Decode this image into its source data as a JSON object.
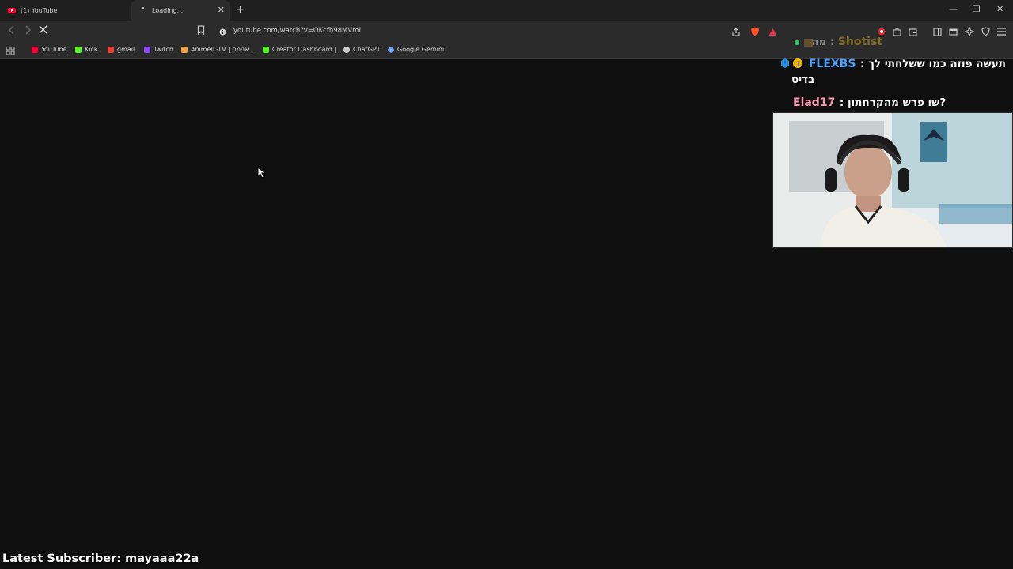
{
  "tabs": [
    {
      "label": "(1) YouTube",
      "icon": "youtube-icon"
    },
    {
      "label": "Loading...",
      "icon": "loading-icon"
    }
  ],
  "window": {
    "minimize": "—",
    "restore": "❐",
    "close": "✕"
  },
  "address": {
    "url": "youtube.com/watch?v=OKcfh98MVmI"
  },
  "bookmarks": [
    {
      "label": "YouTube",
      "color": "#ff0033"
    },
    {
      "label": "Kick",
      "color": "#53fc18"
    },
    {
      "label": "gmail",
      "color": "#ea4335"
    },
    {
      "label": "Twitch",
      "color": "#9146ff"
    },
    {
      "label": "AnimeIL-TV | אנימה...",
      "color": "#f2a33a"
    },
    {
      "label": "Creator Dashboard |...",
      "color": "#53fc18"
    },
    {
      "label": "ChatGPT",
      "color": "#cccccc"
    },
    {
      "label": "Google Gemini",
      "color": "#6fa8ff"
    }
  ],
  "chat": [
    {
      "user": "Shotist",
      "msg": "מה",
      "user_color": "#c9a227"
    },
    {
      "user": "FLEXBS",
      "msg": "תעשה פוזה כמו ששלחתי לך",
      "wrap": "בדיס",
      "user_color": "#4aa3ff"
    },
    {
      "user": "Elad17",
      "msg": "?שו פרש מהקרחתון",
      "user_color": "#ff9eb5"
    }
  ],
  "overlay": {
    "latest_subscriber": "Latest Subscriber: mayaaa22a"
  }
}
